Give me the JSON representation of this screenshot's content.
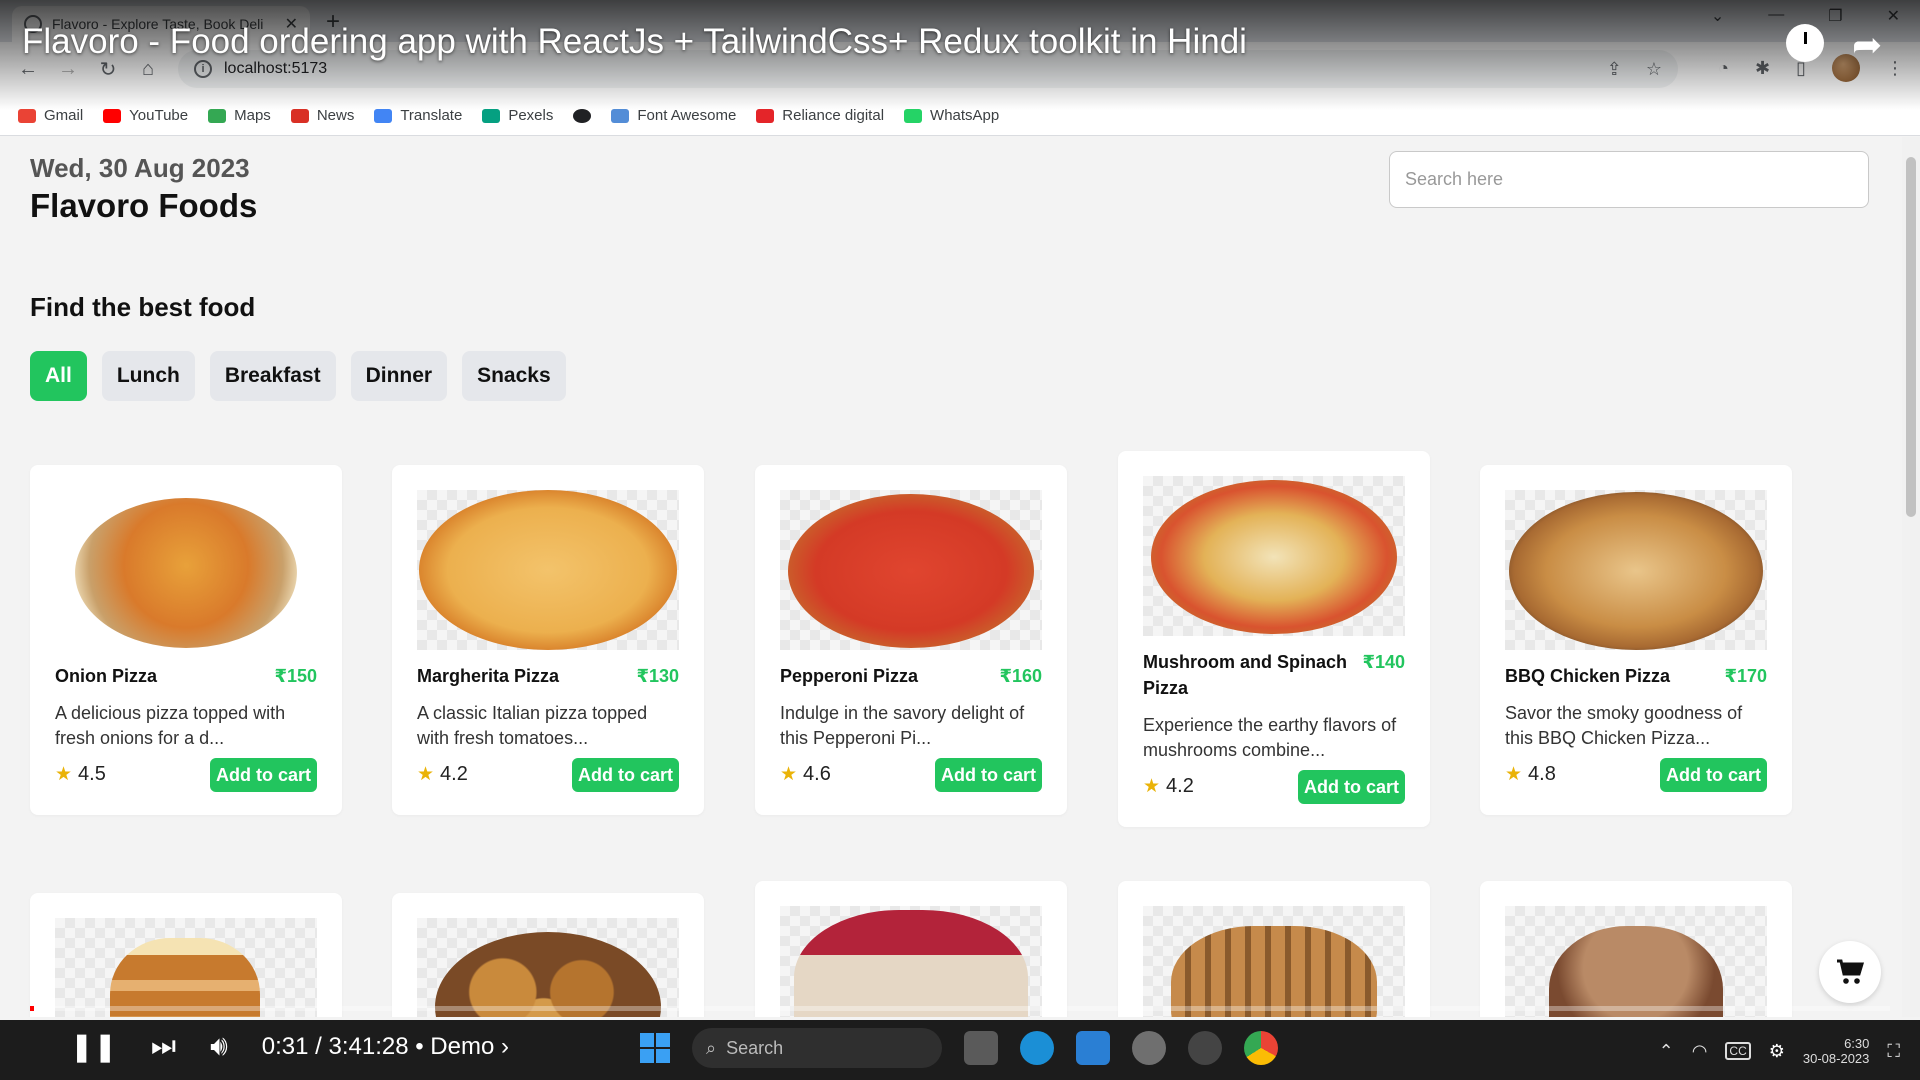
{
  "browser": {
    "tab_title": "Flavoro - Explore Taste, Book Deli",
    "url": "localhost:5173",
    "bookmarks": [
      {
        "label": "Gmail",
        "color": "#ea4335"
      },
      {
        "label": "YouTube",
        "color": "#ff0000"
      },
      {
        "label": "Maps",
        "color": "#34a853"
      },
      {
        "label": "News",
        "color": "#d93025"
      },
      {
        "label": "Translate",
        "color": "#4285f4"
      },
      {
        "label": "Pexels",
        "color": "#05a081"
      },
      {
        "label": "",
        "color": "#202124"
      },
      {
        "label": "Font Awesome",
        "color": "#538dd7"
      },
      {
        "label": "Reliance digital",
        "color": "#e42529"
      },
      {
        "label": "WhatsApp",
        "color": "#25d366"
      }
    ]
  },
  "video": {
    "title": "Flavoro - Food ordering app with ReactJs + TailwindCss+ Redux toolkit in Hindi",
    "time": "0:31 / 3:41:28 • Demo ›"
  },
  "app": {
    "date": "Wed, 30 Aug 2023",
    "brand": "Flavoro Foods",
    "search_placeholder": "Search here",
    "heading": "Find the best food",
    "categories": [
      "All",
      "Lunch",
      "Breakfast",
      "Dinner",
      "Snacks"
    ],
    "add_label": "Add to cart",
    "accent_color": "#22c55e",
    "foods": [
      {
        "name": "Onion Pizza",
        "price": "₹150",
        "desc": "A delicious pizza topped with fresh onions for a d...",
        "rating": "4.5"
      },
      {
        "name": "Margherita Pizza",
        "price": "₹130",
        "desc": "A classic Italian pizza topped with fresh tomatoes...",
        "rating": "4.2"
      },
      {
        "name": "Pepperoni Pizza",
        "price": "₹160",
        "desc": "Indulge in the savory delight of this Pepperoni Pi...",
        "rating": "4.6"
      },
      {
        "name": "Mushroom and Spinach Pizza",
        "price": "₹140",
        "desc": "Experience the earthy flavors of mushrooms combine...",
        "rating": "4.2"
      },
      {
        "name": "BBQ Chicken Pizza",
        "price": "₹170",
        "desc": "Savor the smoky goodness of this BBQ Chicken Pizza...",
        "rating": "4.8"
      }
    ]
  },
  "taskbar": {
    "search_placeholder": "Search",
    "clock_time": "6:30",
    "clock_date": "30-08-2023"
  }
}
